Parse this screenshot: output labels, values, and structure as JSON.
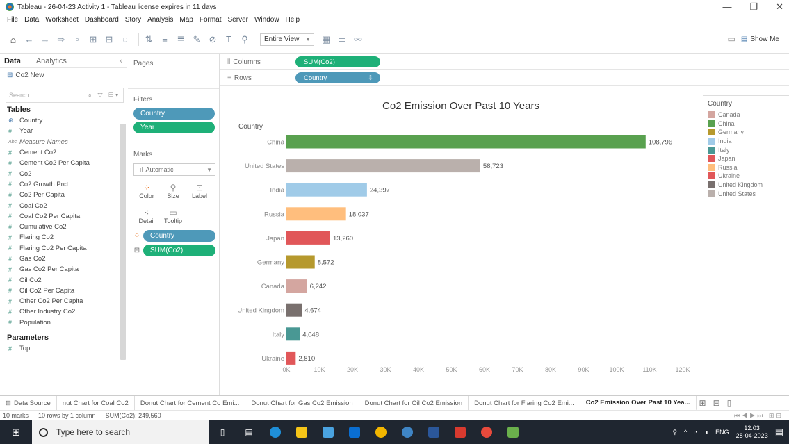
{
  "window": {
    "title": "Tableau - 26-04-23 Activity 1 - Tableau license expires in 11 days",
    "minimize": "—",
    "restore": "❐",
    "close": "✕"
  },
  "menu": [
    "File",
    "Data",
    "Worksheet",
    "Dashboard",
    "Story",
    "Analysis",
    "Map",
    "Format",
    "Server",
    "Window",
    "Help"
  ],
  "toolbar": {
    "view_select": "Entire View",
    "show_me": "Show Me"
  },
  "data_pane": {
    "tab_data": "Data",
    "tab_analytics": "Analytics",
    "datasource": "Co2 New",
    "search_placeholder": "Search",
    "tables_heading": "Tables",
    "fields": [
      {
        "name": "Country",
        "type": "dim"
      },
      {
        "name": "Year",
        "type": "mea"
      },
      {
        "name": "Measure Names",
        "type": "abc"
      },
      {
        "name": "Cement Co2",
        "type": "mea"
      },
      {
        "name": "Cement Co2 Per Capita",
        "type": "mea"
      },
      {
        "name": "Co2",
        "type": "mea"
      },
      {
        "name": "Co2 Growth Prct",
        "type": "mea"
      },
      {
        "name": "Co2 Per Capita",
        "type": "mea"
      },
      {
        "name": "Coal Co2",
        "type": "mea"
      },
      {
        "name": "Coal Co2 Per Capita",
        "type": "mea"
      },
      {
        "name": "Cumulative Co2",
        "type": "mea"
      },
      {
        "name": "Flaring Co2",
        "type": "mea"
      },
      {
        "name": "Flaring Co2 Per Capita",
        "type": "mea"
      },
      {
        "name": "Gas Co2",
        "type": "mea"
      },
      {
        "name": "Gas Co2 Per Capita",
        "type": "mea"
      },
      {
        "name": "Oil Co2",
        "type": "mea"
      },
      {
        "name": "Oil Co2 Per Capita",
        "type": "mea"
      },
      {
        "name": "Other Co2 Per Capita",
        "type": "mea"
      },
      {
        "name": "Other Industry Co2",
        "type": "mea"
      },
      {
        "name": "Population",
        "type": "mea"
      }
    ],
    "parameters_heading": "Parameters",
    "parameters": [
      "Top"
    ]
  },
  "cards": {
    "pages_title": "Pages",
    "filters_title": "Filters",
    "filters": [
      "Country",
      "Year"
    ],
    "marks_title": "Marks",
    "mark_type": "Automatic",
    "mark_buttons": [
      "Color",
      "Size",
      "Label",
      "Detail",
      "Tooltip"
    ],
    "mark_pills": [
      "Country",
      "SUM(Co2)"
    ]
  },
  "shelves": {
    "columns_label": "Columns",
    "columns_pill": "SUM(Co2)",
    "rows_label": "Rows",
    "rows_pill": "Country"
  },
  "chart_data": {
    "type": "bar",
    "title": "Co2 Emission Over Past 10 Years",
    "y_header": "Country",
    "categories": [
      "China",
      "United States",
      "India",
      "Russia",
      "Japan",
      "Germany",
      "Canada",
      "United Kingdom",
      "Italy",
      "Ukraine"
    ],
    "values": [
      108796,
      58723,
      24397,
      18037,
      13260,
      8572,
      6242,
      4674,
      4048,
      2810
    ],
    "value_labels": [
      "108,796",
      "58,723",
      "24,397",
      "18,037",
      "13,260",
      "8,572",
      "6,242",
      "4,674",
      "4,048",
      "2,810"
    ],
    "colors": [
      "#59a14f",
      "#bab0ac",
      "#a0cbe8",
      "#ffbe7d",
      "#e15759",
      "#b6992d",
      "#d4a6a0",
      "#79706e",
      "#499894",
      "#e15759"
    ],
    "x_ticks": [
      "0K",
      "10K",
      "20K",
      "30K",
      "40K",
      "50K",
      "60K",
      "70K",
      "80K",
      "90K",
      "100K",
      "110K",
      "120K"
    ],
    "xlim": [
      0,
      120000
    ],
    "orientation": "horizontal"
  },
  "legend": {
    "title": "Country",
    "items": [
      {
        "label": "Canada",
        "color": "#d4a6a0"
      },
      {
        "label": "China",
        "color": "#59a14f"
      },
      {
        "label": "Germany",
        "color": "#b6992d"
      },
      {
        "label": "India",
        "color": "#a0cbe8"
      },
      {
        "label": "Italy",
        "color": "#499894"
      },
      {
        "label": "Japan",
        "color": "#e15759"
      },
      {
        "label": "Russia",
        "color": "#ffbe7d"
      },
      {
        "label": "Ukraine",
        "color": "#e15759"
      },
      {
        "label": "United Kingdom",
        "color": "#79706e"
      },
      {
        "label": "United States",
        "color": "#bab0ac"
      }
    ]
  },
  "sheet_tabs": [
    "Data Source",
    "nut Chart for Coal Co2",
    "Donut Chart for Cement Co Emi...",
    "Donut Chart for Gas Co2 Emission",
    "Donut Chart for Oil Co2 Emission",
    "Donut Chart for Flaring Co2 Emi...",
    "Co2 Emission Over Past 10 Yea..."
  ],
  "status": {
    "marks": "10 marks",
    "rows": "10 rows by 1 column",
    "sum": "SUM(Co2): 249,560"
  },
  "taskbar": {
    "search_placeholder": "Type here to search",
    "lang": "ENG",
    "time": "12:03",
    "date": "28-04-2023"
  }
}
